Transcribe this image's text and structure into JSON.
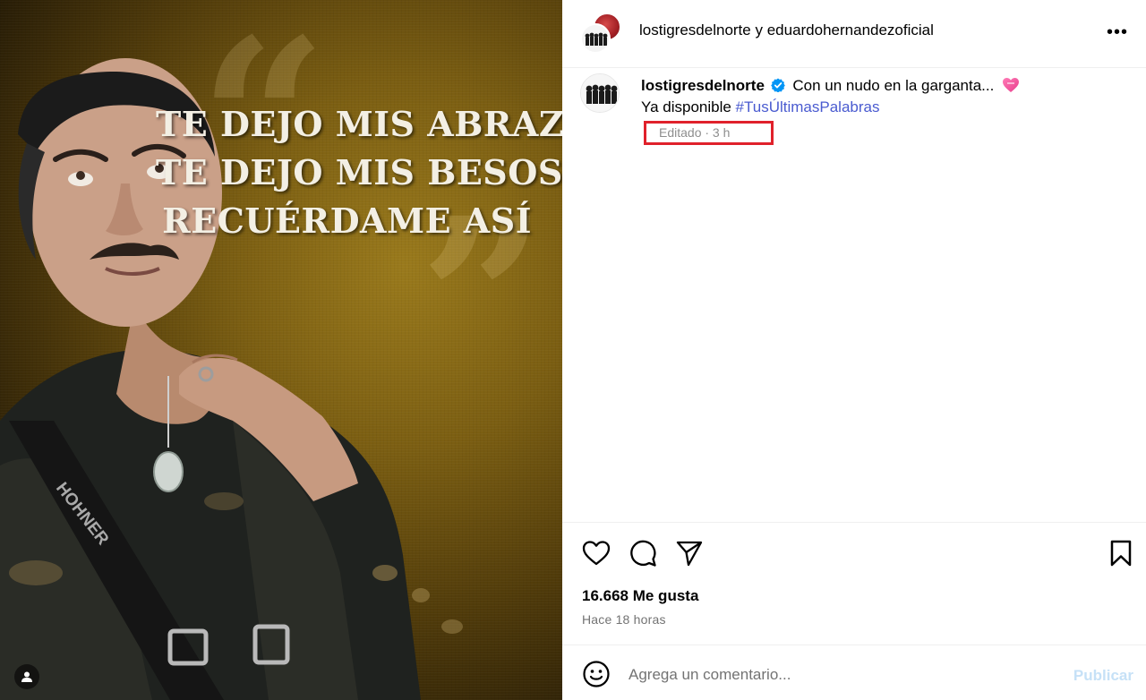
{
  "post": {
    "quote_lines": [
      "TE DEJO MIS ABRAZOS",
      "TE DEJO MIS BESOS",
      "RECUÉRDAME ASÍ"
    ],
    "image_brand_text": "HOHNER"
  },
  "header": {
    "author_primary": "lostigresdelnorte",
    "conjunction": " y ",
    "author_secondary": "eduardohernandezoficial",
    "more_icon": "more-horizontal-icon",
    "more_label": "•••"
  },
  "caption": {
    "username": "lostigresdelnorte",
    "text": "Con un nudo en la garganta...",
    "line2_text": "Ya disponible ",
    "hashtag": "#TusÚltimasPalabras",
    "meta": "Editado · 3 h",
    "verified_color": "#0095f6",
    "highlight_color": "#e0212b"
  },
  "actions": {
    "like_icon": "heart-icon",
    "comment_icon": "comment-bubble-icon",
    "share_icon": "paper-plane-icon",
    "save_icon": "bookmark-icon"
  },
  "stats": {
    "likes": "16.668 Me gusta",
    "time": "Hace 18 horas"
  },
  "comment": {
    "placeholder": "Agrega un comentario...",
    "publish_label": "Publicar"
  }
}
